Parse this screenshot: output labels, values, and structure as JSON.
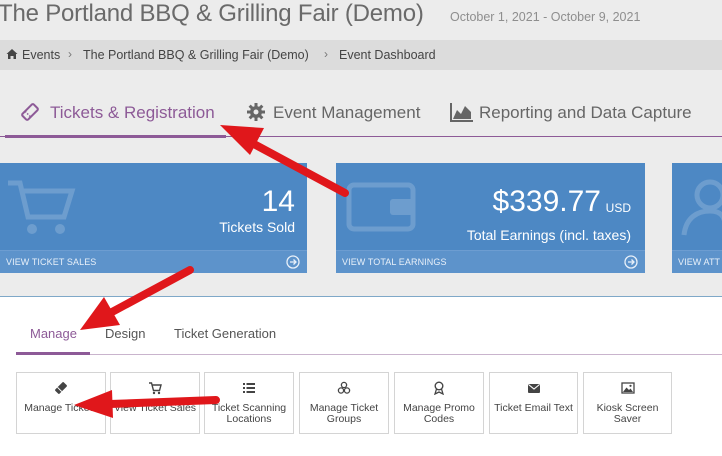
{
  "header": {
    "event_title": "The Portland BBQ & Grilling Fair (Demo)",
    "event_dates": "October 1, 2021 - October 9, 2021"
  },
  "breadcrumb": {
    "items": [
      "Events",
      "The Portland BBQ & Grilling Fair (Demo)",
      "Event Dashboard"
    ],
    "separator": "›"
  },
  "main_tabs": [
    {
      "label": "Tickets & Registration",
      "icon": "ticket-icon",
      "active": true
    },
    {
      "label": "Event Management",
      "icon": "gear-icon",
      "active": false
    },
    {
      "label": "Reporting and Data Capture",
      "icon": "area-chart-icon",
      "active": false
    }
  ],
  "stats": {
    "tickets": {
      "value": "14",
      "label": "Tickets Sold",
      "footer": "VIEW TICKET SALES",
      "icon": "shopping-cart-icon"
    },
    "earnings": {
      "value": "$339.77",
      "currency": "USD",
      "label": "Total Earnings (incl. taxes)",
      "footer": "VIEW TOTAL EARNINGS",
      "icon": "wallet-icon"
    },
    "attendees": {
      "footer": "VIEW ATT",
      "icon": "user-icon"
    }
  },
  "sub_tabs": [
    {
      "label": "Manage",
      "active": true
    },
    {
      "label": "Design",
      "active": false
    },
    {
      "label": "Ticket Generation",
      "active": false
    }
  ],
  "tiles": [
    {
      "label": "Manage Tickets",
      "icon": "ticket-icon"
    },
    {
      "label": "View Ticket Sales",
      "icon": "shopping-cart-icon"
    },
    {
      "label": "Ticket Scanning Locations",
      "icon": "list-icon"
    },
    {
      "label": "Manage Ticket Groups",
      "icon": "cubes-icon"
    },
    {
      "label": "Manage Promo Codes",
      "icon": "award-icon"
    },
    {
      "label": "Ticket Email Text",
      "icon": "envelope-icon"
    },
    {
      "label": "Kiosk Screen Saver",
      "icon": "image-icon"
    }
  ],
  "colors": {
    "accent": "#8d5a97",
    "card_blue": "#4d88c4",
    "annotation_arrow": "#e0171b"
  }
}
